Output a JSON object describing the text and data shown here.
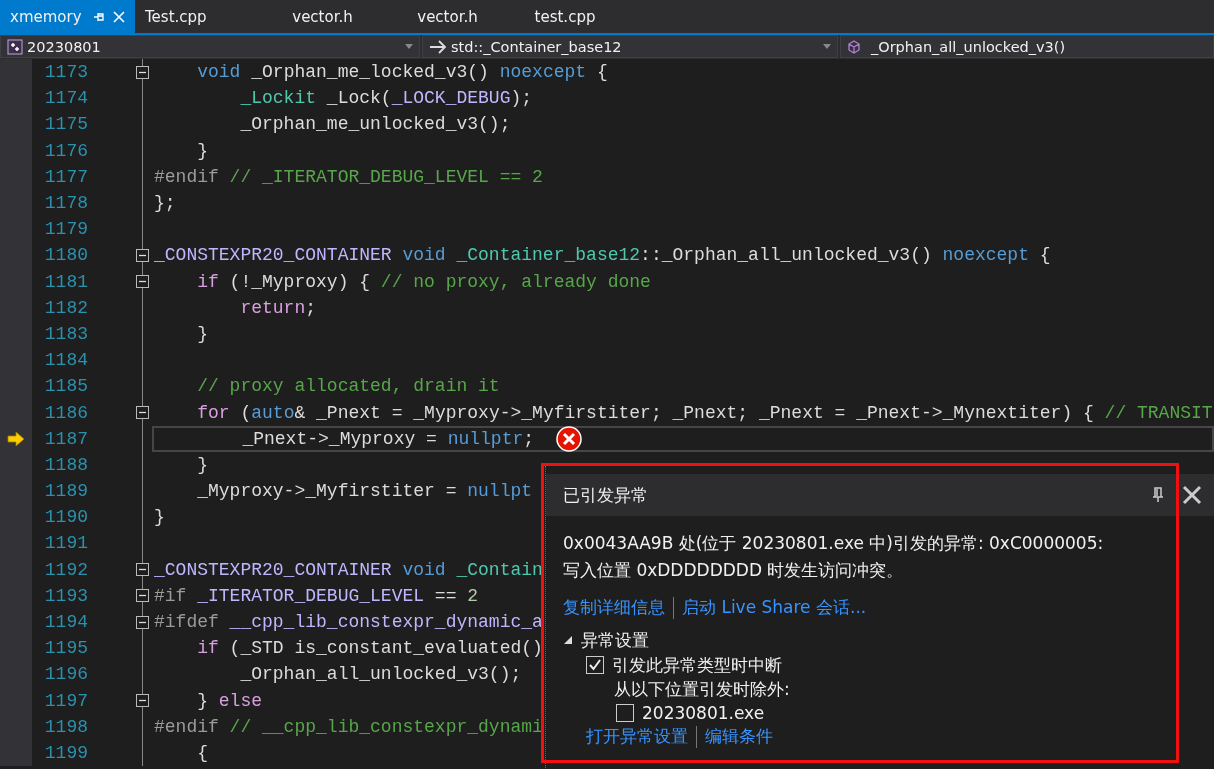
{
  "tabs": [
    {
      "label": "xmemory",
      "selected": true
    },
    {
      "label": "Test.cpp",
      "selected": false
    },
    {
      "label": "vector.h",
      "selected": false
    },
    {
      "label": "vector.h",
      "selected": false
    },
    {
      "label": "test.cpp",
      "selected": false
    }
  ],
  "nav": {
    "project": "20230801",
    "scope": "std::_Container_base12",
    "member": "_Orphan_all_unlocked_v3()"
  },
  "lines": [
    {
      "n": "1173",
      "fold": true,
      "current": false,
      "error": false,
      "tokens": [
        {
          "kind": "kw",
          "text": "    void"
        },
        {
          "kind": "plain",
          "text": " _Orphan_me_locked_v3() "
        },
        {
          "kind": "kw",
          "text": "noexcept"
        },
        {
          "kind": "plain",
          "text": " {"
        }
      ]
    },
    {
      "n": "1174",
      "fold": false,
      "current": false,
      "error": false,
      "tokens": [
        {
          "kind": "type",
          "text": "        _Lockit"
        },
        {
          "kind": "plain",
          "text": " _Lock("
        },
        {
          "kind": "macro",
          "text": "_LOCK_DEBUG"
        },
        {
          "kind": "plain",
          "text": ");"
        }
      ]
    },
    {
      "n": "1175",
      "fold": false,
      "current": false,
      "error": false,
      "tokens": [
        {
          "kind": "plain",
          "text": "        _Orphan_me_unlocked_v3();"
        }
      ]
    },
    {
      "n": "1176",
      "fold": false,
      "current": false,
      "error": false,
      "tokens": [
        {
          "kind": "plain",
          "text": "    }"
        }
      ]
    },
    {
      "n": "1177",
      "fold": false,
      "current": false,
      "error": false,
      "tokens": [
        {
          "kind": "pre",
          "text": "#endif"
        },
        {
          "kind": "comment",
          "text": " // _ITERATOR_DEBUG_LEVEL == 2"
        }
      ]
    },
    {
      "n": "1178",
      "fold": false,
      "current": false,
      "error": false,
      "tokens": [
        {
          "kind": "plain",
          "text": "};"
        }
      ]
    },
    {
      "n": "1179",
      "fold": false,
      "current": false,
      "error": false
    },
    {
      "n": "1180",
      "fold": true,
      "current": false,
      "error": false,
      "tokens": [
        {
          "kind": "macro",
          "text": "_CONSTEXPR20_CONTAINER"
        },
        {
          "kind": "kw",
          "text": " void "
        },
        {
          "kind": "type",
          "text": "_Container_base12"
        },
        {
          "kind": "plain",
          "text": "::_Orphan_all_unlocked_v3() "
        },
        {
          "kind": "kw",
          "text": "noexcept"
        },
        {
          "kind": "plain",
          "text": " {"
        }
      ]
    },
    {
      "n": "1181",
      "fold": true,
      "current": false,
      "error": false,
      "tokens": [
        {
          "kind": "ctrl",
          "text": "    if"
        },
        {
          "kind": "plain",
          "text": " (!_Myproxy) { "
        },
        {
          "kind": "comment",
          "text": "// no proxy, already done"
        }
      ]
    },
    {
      "n": "1182",
      "fold": false,
      "current": false,
      "error": false,
      "tokens": [
        {
          "kind": "ctrl",
          "text": "        return"
        },
        {
          "kind": "plain",
          "text": ";"
        }
      ]
    },
    {
      "n": "1183",
      "fold": false,
      "current": false,
      "error": false,
      "tokens": [
        {
          "kind": "plain",
          "text": "    }"
        }
      ]
    },
    {
      "n": "1184",
      "fold": false,
      "current": false,
      "error": false
    },
    {
      "n": "1185",
      "fold": false,
      "current": false,
      "error": false,
      "tokens": [
        {
          "kind": "comment",
          "text": "    // proxy allocated, drain it"
        }
      ]
    },
    {
      "n": "1186",
      "fold": true,
      "current": false,
      "error": false,
      "tokens": [
        {
          "kind": "ctrl",
          "text": "    for"
        },
        {
          "kind": "plain",
          "text": " ("
        },
        {
          "kind": "kw",
          "text": "auto"
        },
        {
          "kind": "plain",
          "text": "& _Pnext = _Myproxy->_Myfirstiter; _Pnext; _Pnext = _Pnext->_Mynextiter) { "
        },
        {
          "kind": "comment",
          "text": "// TRANSIT"
        }
      ]
    },
    {
      "n": "1187",
      "fold": false,
      "current": true,
      "error": true,
      "tokens": [
        {
          "kind": "plain",
          "text": "        _Pnext->_Myproxy = "
        },
        {
          "kind": "kw",
          "text": "nullptr"
        },
        {
          "kind": "plain",
          "text": ";"
        }
      ]
    },
    {
      "n": "1188",
      "fold": false,
      "current": false,
      "error": false,
      "tokens": [
        {
          "kind": "plain",
          "text": "    }"
        }
      ]
    },
    {
      "n": "1189",
      "fold": false,
      "current": false,
      "error": false,
      "tokens": [
        {
          "kind": "plain",
          "text": "    _Myproxy->_Myfirstiter = "
        },
        {
          "kind": "kw",
          "text": "nullpt"
        }
      ]
    },
    {
      "n": "1190",
      "fold": false,
      "current": false,
      "error": false,
      "tokens": [
        {
          "kind": "plain",
          "text": "}"
        }
      ]
    },
    {
      "n": "1191",
      "fold": false,
      "current": false,
      "error": false
    },
    {
      "n": "1192",
      "fold": true,
      "current": false,
      "error": false,
      "tokens": [
        {
          "kind": "macro",
          "text": "_CONSTEXPR20_CONTAINER"
        },
        {
          "kind": "kw",
          "text": " void "
        },
        {
          "kind": "type",
          "text": "_Contain"
        }
      ]
    },
    {
      "n": "1193",
      "fold": true,
      "current": false,
      "error": false,
      "tokens": [
        {
          "kind": "pre",
          "text": "#if"
        },
        {
          "kind": "macro",
          "text": " _ITERATOR_DEBUG_LEVEL"
        },
        {
          "kind": "plain",
          "text": " == "
        },
        {
          "kind": "number",
          "text": "2"
        }
      ]
    },
    {
      "n": "1194",
      "fold": true,
      "current": false,
      "error": false,
      "tokens": [
        {
          "kind": "pre",
          "text": "#ifdef"
        },
        {
          "kind": "macro",
          "text": " __cpp_lib_constexpr_dynamic_a"
        }
      ]
    },
    {
      "n": "1195",
      "fold": false,
      "current": false,
      "error": false,
      "tokens": [
        {
          "kind": "ctrl",
          "text": "    if"
        },
        {
          "kind": "plain",
          "text": " (_STD is_constant_evaluated()"
        }
      ]
    },
    {
      "n": "1196",
      "fold": false,
      "current": false,
      "error": false,
      "tokens": [
        {
          "kind": "plain",
          "text": "        _Orphan_all_unlocked_v3();"
        }
      ]
    },
    {
      "n": "1197",
      "fold": true,
      "current": false,
      "error": false,
      "tokens": [
        {
          "kind": "plain",
          "text": "    } "
        },
        {
          "kind": "ctrl",
          "text": "else"
        }
      ]
    },
    {
      "n": "1198",
      "fold": false,
      "current": false,
      "error": false,
      "tokens": [
        {
          "kind": "pre",
          "text": "#endif"
        },
        {
          "kind": "comment",
          "text": " // __cpp_lib_constexpr_dynami"
        }
      ]
    },
    {
      "n": "1199",
      "fold": false,
      "current": false,
      "error": false,
      "tokens": [
        {
          "kind": "plain",
          "text": "    {"
        }
      ]
    }
  ],
  "exception_popup": {
    "title": "已引发异常",
    "message": [
      "0x0043AA9B 处(位于 20230801.exe 中)引发的异常: 0xC0000005:",
      "写入位置 0xDDDDDDDD 时发生访问冲突。"
    ],
    "links": [
      "复制详细信息",
      "启动 Live Share 会话..."
    ],
    "settings": {
      "label": "异常设置",
      "expanded": true,
      "break_option": {
        "label": "引发此异常类型时中断",
        "checked": true
      },
      "except_label": "从以下位置引发时除外:",
      "exceptions": [
        {
          "label": "20230801.exe",
          "checked": false
        }
      ]
    },
    "bottom_links": [
      "打开异常设置",
      "编辑条件"
    ]
  }
}
